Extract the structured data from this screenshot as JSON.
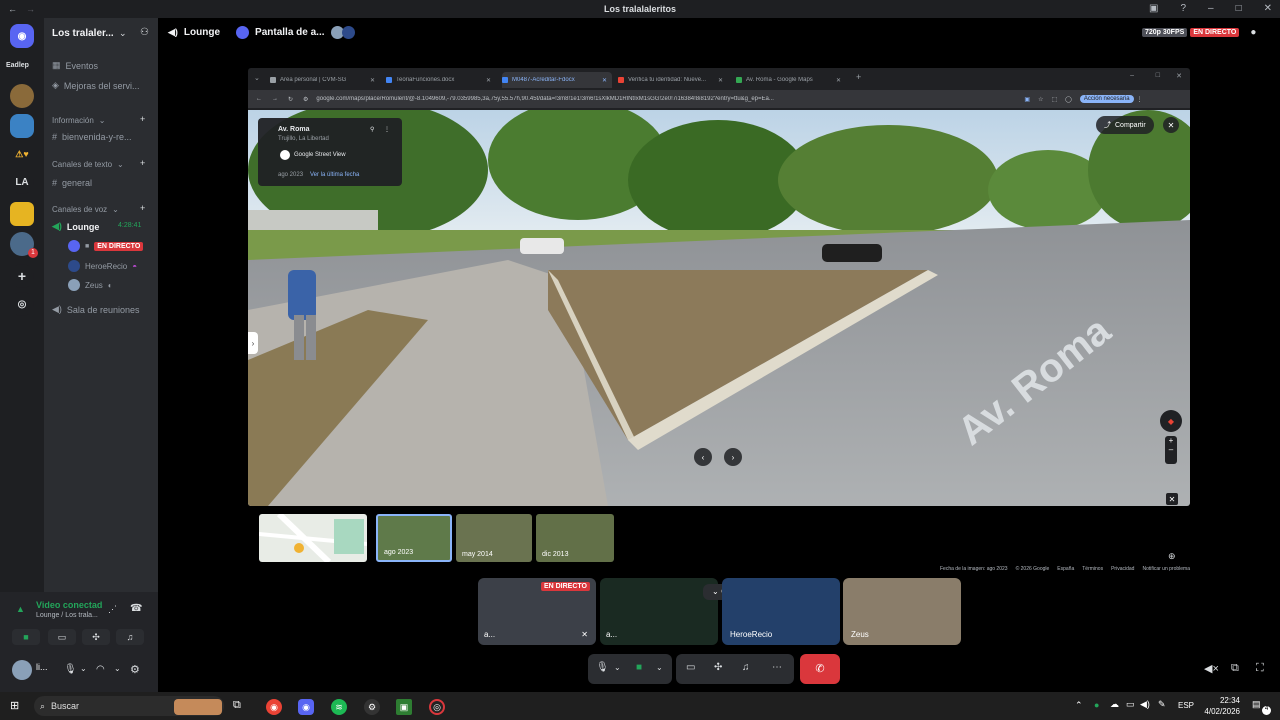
{
  "window": {
    "title": "Los tralalaleritos",
    "quality": "720p 30FPS",
    "live": "EN DIRECTO"
  },
  "voice_header": {
    "channel": "Lounge",
    "stream_label": "Pantalla de a..."
  },
  "server": {
    "name": "Los tralaler...",
    "events": "Eventos",
    "boosts": "Mejoras del servi...",
    "info_category": "Información",
    "welcome_channel": "bienvenida-y-re...",
    "text_category": "Canales de texto",
    "general_channel": "general",
    "voice_category": "Canales de voz",
    "lounge": "Lounge",
    "lounge_timer": "4:28:41",
    "live_badge": "EN DIRECTO",
    "member1": "HeroeRecio",
    "member2": "Zeus",
    "meeting_room": "Sala de reuniones"
  },
  "rail": {
    "badge_label": "Eadlep",
    "la_label": "LA",
    "notif_count": "1"
  },
  "user_panel": {
    "status": "Video conectad",
    "location": "Lounge / Los trala...",
    "username": "li..."
  },
  "browser": {
    "tabs": [
      {
        "label": "Área personal | CVM-SG",
        "color": "#9aa0a6"
      },
      {
        "label": "TeoriaFunciones.docx",
        "color": "#4285f4"
      },
      {
        "label": "M0487-Acreditar-Fdocx",
        "color": "#4285f4"
      },
      {
        "label": "Verifica tu identidad: Nueve...",
        "color": "#ea4335"
      },
      {
        "label": "Av. Roma - Google Maps",
        "color": "#34a853"
      }
    ],
    "url": "google.com/maps/place/Romulent/@-8.1049609,-79.0359985,3a,75y,55.57h,90.45t/data=!3m8!1e1!3m6!1sXlkMD1RlNtIxM1sGG!2e0!7i16384!8i8192?entry=ttu&g_ep=Ea...",
    "action": "Acción necesaria",
    "share": "Compartir"
  },
  "streetview": {
    "place": "Av. Roma",
    "region": "Trujillo, La Libertad",
    "provider": "Google Street View",
    "date": "ago 2023",
    "latest_link": "Ver la última fecha",
    "road_text": "Av. Roma",
    "footer": [
      "Fecha de la imagen: ago 2023",
      "© 2026 Google",
      "España",
      "Términos",
      "Privacidad",
      "Notificar un problema"
    ]
  },
  "thumbs": [
    {
      "label": "",
      "map": true
    },
    {
      "label": "ago 2023"
    },
    {
      "label": "may 2014"
    },
    {
      "label": "dic 2013"
    }
  ],
  "participants": [
    {
      "name": "a...",
      "live": "EN DIRECTO"
    },
    {
      "name": "a..."
    },
    {
      "name": "HeroeRecio"
    },
    {
      "name": "Zeus"
    }
  ],
  "taskbar": {
    "search": "Buscar",
    "lang": "ESP",
    "time": "22:34",
    "date": "4/02/2026",
    "notif": "4"
  },
  "colors": {
    "discord_bg": "#2b2d31",
    "rail_bg": "#1e1f22",
    "live_red": "#da373c",
    "green": "#23a55a",
    "blurple": "#5865f2"
  }
}
